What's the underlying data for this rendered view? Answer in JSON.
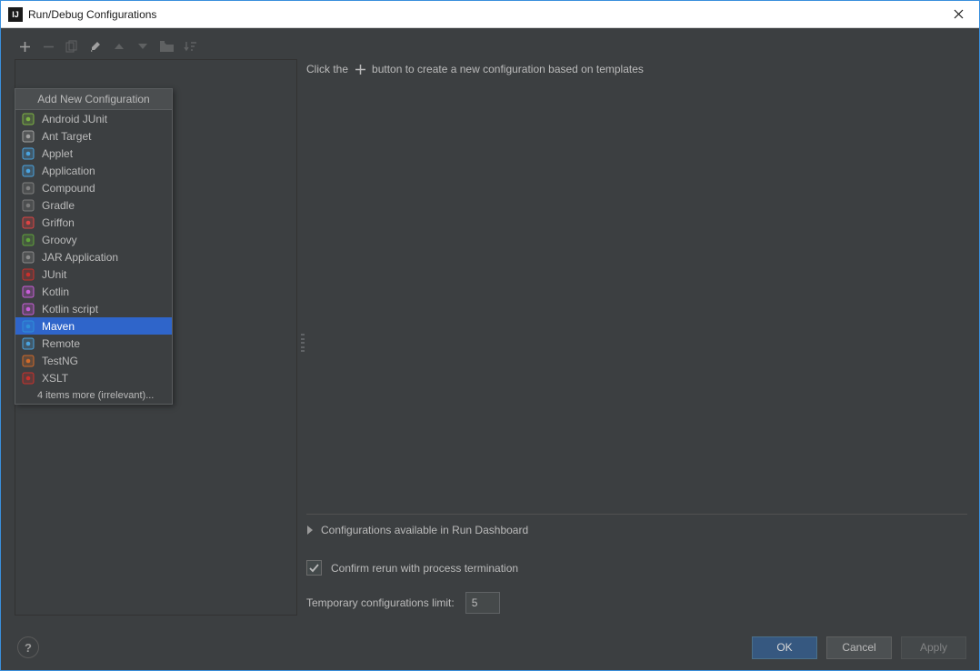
{
  "titlebar": {
    "title": "Run/Debug Configurations"
  },
  "toolbar": {
    "add_tooltip": "Add New Configuration",
    "remove_tooltip": "Remove Configuration",
    "copy_tooltip": "Copy Configuration",
    "edit_tooltip": "Edit",
    "up_tooltip": "Move Up",
    "down_tooltip": "Move Down",
    "folder_tooltip": "Create Folder",
    "sort_tooltip": "Sort"
  },
  "dropdown": {
    "header": "Add New Configuration",
    "items": [
      {
        "label": "Android JUnit",
        "icon": "android-junit-icon",
        "color": "#7cb342"
      },
      {
        "label": "Ant Target",
        "icon": "ant-icon",
        "color": "#a0a0a0"
      },
      {
        "label": "Applet",
        "icon": "applet-icon",
        "color": "#4aa3df"
      },
      {
        "label": "Application",
        "icon": "application-icon",
        "color": "#4aa3df"
      },
      {
        "label": "Compound",
        "icon": "compound-icon",
        "color": "#808080"
      },
      {
        "label": "Gradle",
        "icon": "gradle-icon",
        "color": "#7a7a7a"
      },
      {
        "label": "Griffon",
        "icon": "griffon-icon",
        "color": "#d44"
      },
      {
        "label": "Groovy",
        "icon": "groovy-icon",
        "color": "#5fa33a"
      },
      {
        "label": "JAR Application",
        "icon": "jar-icon",
        "color": "#8a8a8a"
      },
      {
        "label": "JUnit",
        "icon": "junit-icon",
        "color": "#c9302c"
      },
      {
        "label": "Kotlin",
        "icon": "kotlin-icon",
        "color": "#c75dd8"
      },
      {
        "label": "Kotlin script",
        "icon": "kotlin-script-icon",
        "color": "#c75dd8"
      },
      {
        "label": "Maven",
        "icon": "maven-icon",
        "color": "#2f8fd8",
        "selected": true
      },
      {
        "label": "Remote",
        "icon": "remote-icon",
        "color": "#4aa3df"
      },
      {
        "label": "TestNG",
        "icon": "testng-icon",
        "color": "#d06a2a"
      },
      {
        "label": "XSLT",
        "icon": "xslt-icon",
        "color": "#c9302c"
      }
    ],
    "more": "4 items more (irrelevant)..."
  },
  "right": {
    "hint_prefix": "Click the",
    "hint_suffix": "button to create a new configuration based on templates",
    "dashboard_label": "Configurations available in Run Dashboard",
    "confirm_rerun_label": "Confirm rerun with process termination",
    "confirm_rerun_checked": true,
    "temp_limit_label": "Temporary configurations limit:",
    "temp_limit_value": "5"
  },
  "footer": {
    "ok": "OK",
    "cancel": "Cancel",
    "apply": "Apply"
  }
}
